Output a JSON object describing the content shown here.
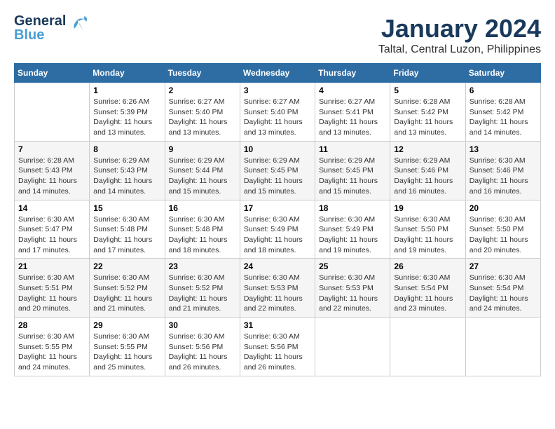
{
  "logo": {
    "general": "General",
    "blue": "Blue"
  },
  "title": "January 2024",
  "subtitle": "Taltal, Central Luzon, Philippines",
  "headers": [
    "Sunday",
    "Monday",
    "Tuesday",
    "Wednesday",
    "Thursday",
    "Friday",
    "Saturday"
  ],
  "weeks": [
    [
      {
        "day": "",
        "info": ""
      },
      {
        "day": "1",
        "info": "Sunrise: 6:26 AM\nSunset: 5:39 PM\nDaylight: 11 hours\nand 13 minutes."
      },
      {
        "day": "2",
        "info": "Sunrise: 6:27 AM\nSunset: 5:40 PM\nDaylight: 11 hours\nand 13 minutes."
      },
      {
        "day": "3",
        "info": "Sunrise: 6:27 AM\nSunset: 5:40 PM\nDaylight: 11 hours\nand 13 minutes."
      },
      {
        "day": "4",
        "info": "Sunrise: 6:27 AM\nSunset: 5:41 PM\nDaylight: 11 hours\nand 13 minutes."
      },
      {
        "day": "5",
        "info": "Sunrise: 6:28 AM\nSunset: 5:42 PM\nDaylight: 11 hours\nand 13 minutes."
      },
      {
        "day": "6",
        "info": "Sunrise: 6:28 AM\nSunset: 5:42 PM\nDaylight: 11 hours\nand 14 minutes."
      }
    ],
    [
      {
        "day": "7",
        "info": "Sunrise: 6:28 AM\nSunset: 5:43 PM\nDaylight: 11 hours\nand 14 minutes."
      },
      {
        "day": "8",
        "info": "Sunrise: 6:29 AM\nSunset: 5:43 PM\nDaylight: 11 hours\nand 14 minutes."
      },
      {
        "day": "9",
        "info": "Sunrise: 6:29 AM\nSunset: 5:44 PM\nDaylight: 11 hours\nand 15 minutes."
      },
      {
        "day": "10",
        "info": "Sunrise: 6:29 AM\nSunset: 5:45 PM\nDaylight: 11 hours\nand 15 minutes."
      },
      {
        "day": "11",
        "info": "Sunrise: 6:29 AM\nSunset: 5:45 PM\nDaylight: 11 hours\nand 15 minutes."
      },
      {
        "day": "12",
        "info": "Sunrise: 6:29 AM\nSunset: 5:46 PM\nDaylight: 11 hours\nand 16 minutes."
      },
      {
        "day": "13",
        "info": "Sunrise: 6:30 AM\nSunset: 5:46 PM\nDaylight: 11 hours\nand 16 minutes."
      }
    ],
    [
      {
        "day": "14",
        "info": "Sunrise: 6:30 AM\nSunset: 5:47 PM\nDaylight: 11 hours\nand 17 minutes."
      },
      {
        "day": "15",
        "info": "Sunrise: 6:30 AM\nSunset: 5:48 PM\nDaylight: 11 hours\nand 17 minutes."
      },
      {
        "day": "16",
        "info": "Sunrise: 6:30 AM\nSunset: 5:48 PM\nDaylight: 11 hours\nand 18 minutes."
      },
      {
        "day": "17",
        "info": "Sunrise: 6:30 AM\nSunset: 5:49 PM\nDaylight: 11 hours\nand 18 minutes."
      },
      {
        "day": "18",
        "info": "Sunrise: 6:30 AM\nSunset: 5:49 PM\nDaylight: 11 hours\nand 19 minutes."
      },
      {
        "day": "19",
        "info": "Sunrise: 6:30 AM\nSunset: 5:50 PM\nDaylight: 11 hours\nand 19 minutes."
      },
      {
        "day": "20",
        "info": "Sunrise: 6:30 AM\nSunset: 5:50 PM\nDaylight: 11 hours\nand 20 minutes."
      }
    ],
    [
      {
        "day": "21",
        "info": "Sunrise: 6:30 AM\nSunset: 5:51 PM\nDaylight: 11 hours\nand 20 minutes."
      },
      {
        "day": "22",
        "info": "Sunrise: 6:30 AM\nSunset: 5:52 PM\nDaylight: 11 hours\nand 21 minutes."
      },
      {
        "day": "23",
        "info": "Sunrise: 6:30 AM\nSunset: 5:52 PM\nDaylight: 11 hours\nand 21 minutes."
      },
      {
        "day": "24",
        "info": "Sunrise: 6:30 AM\nSunset: 5:53 PM\nDaylight: 11 hours\nand 22 minutes."
      },
      {
        "day": "25",
        "info": "Sunrise: 6:30 AM\nSunset: 5:53 PM\nDaylight: 11 hours\nand 22 minutes."
      },
      {
        "day": "26",
        "info": "Sunrise: 6:30 AM\nSunset: 5:54 PM\nDaylight: 11 hours\nand 23 minutes."
      },
      {
        "day": "27",
        "info": "Sunrise: 6:30 AM\nSunset: 5:54 PM\nDaylight: 11 hours\nand 24 minutes."
      }
    ],
    [
      {
        "day": "28",
        "info": "Sunrise: 6:30 AM\nSunset: 5:55 PM\nDaylight: 11 hours\nand 24 minutes."
      },
      {
        "day": "29",
        "info": "Sunrise: 6:30 AM\nSunset: 5:55 PM\nDaylight: 11 hours\nand 25 minutes."
      },
      {
        "day": "30",
        "info": "Sunrise: 6:30 AM\nSunset: 5:56 PM\nDaylight: 11 hours\nand 26 minutes."
      },
      {
        "day": "31",
        "info": "Sunrise: 6:30 AM\nSunset: 5:56 PM\nDaylight: 11 hours\nand 26 minutes."
      },
      {
        "day": "",
        "info": ""
      },
      {
        "day": "",
        "info": ""
      },
      {
        "day": "",
        "info": ""
      }
    ]
  ]
}
